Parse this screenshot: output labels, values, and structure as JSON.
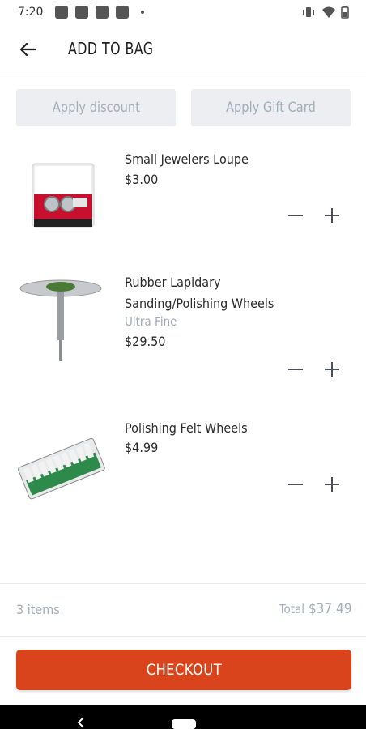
{
  "status_bar": {
    "time": "7:20"
  },
  "app_bar": {
    "title": "ADD TO BAG"
  },
  "actions": {
    "apply_discount": "Apply discount",
    "apply_gift_card": "Apply Gift Card"
  },
  "cart": {
    "items": [
      {
        "name": "Small Jewelers Loupe",
        "variant": "",
        "price": "$3.00"
      },
      {
        "name": "Rubber Lapidary Sanding/Polishing Wheels",
        "variant": "Ultra Fine",
        "price": "$29.50"
      },
      {
        "name": "Polishing Felt Wheels",
        "variant": "",
        "price": "$4.99"
      }
    ]
  },
  "summary": {
    "items_count": "3 items",
    "total_label": "Total",
    "total_value": "$37.49"
  },
  "checkout": {
    "label": "CHECKOUT"
  },
  "colors": {
    "accent": "#d9441c",
    "muted_text": "#a3adbb",
    "button_bg": "#eceef1"
  }
}
